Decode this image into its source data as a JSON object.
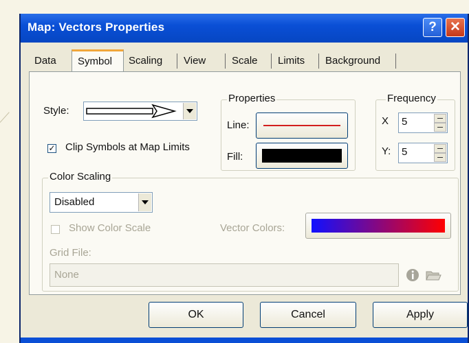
{
  "window": {
    "title": "Map: Vectors Properties",
    "help_glyph": "?",
    "close_glyph": "✕"
  },
  "tabs": [
    {
      "label": "Data",
      "active": false
    },
    {
      "label": "Symbol",
      "active": true
    },
    {
      "label": "Scaling",
      "active": false
    },
    {
      "label": "View",
      "active": false
    },
    {
      "label": "Scale",
      "active": false
    },
    {
      "label": "Limits",
      "active": false
    },
    {
      "label": "Background",
      "active": false
    }
  ],
  "symbol": {
    "style_label": "Style:",
    "clip_label": "Clip Symbols at Map Limits",
    "clip_checked": true,
    "check_glyph": "✓"
  },
  "properties": {
    "group_label": "Properties",
    "line_label": "Line:",
    "fill_label": "Fill:",
    "line_color": "#d21e1e",
    "fill_color": "#000000"
  },
  "frequency": {
    "group_label": "Frequency",
    "x_label": "X",
    "x_value": "5",
    "y_label": "Y:",
    "y_value": "5"
  },
  "color_scaling": {
    "group_label": "Color Scaling",
    "mode_value": "Disabled",
    "show_scale_label": "Show Color Scale",
    "vector_colors_label": "Vector Colors:",
    "gradient_start": "#1010ff",
    "gradient_end": "#ff0000",
    "grid_file_label": "Grid File:",
    "grid_file_value": "None"
  },
  "buttons": {
    "ok": "OK",
    "cancel": "Cancel",
    "apply": "Apply"
  }
}
